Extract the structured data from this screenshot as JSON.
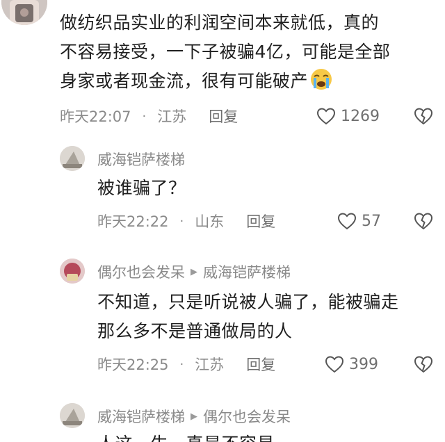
{
  "comments": [
    {
      "text_lines": [
        "做纺织品实业的利润空间本来就低，真的",
        "不容易接受，一下子被骗4亿，可能是全部",
        "身家或者现金流，很有可能破产"
      ],
      "emoji": "crying-face-emoji",
      "time": "昨天22:07",
      "location": "江苏",
      "reply_label": "回复",
      "likes": "1269"
    }
  ],
  "replies": [
    {
      "author": "威海铠萨楼梯",
      "reply_to": "",
      "text_lines": [
        "被谁骗了？"
      ],
      "time": "昨天22:22",
      "location": "山东",
      "reply_label": "回复",
      "likes": "57"
    },
    {
      "author": "偶尔也会发呆",
      "reply_to": "威海铠萨楼梯",
      "text_lines": [
        "不知道，只是听说被人骗了，能被骗走",
        "那么多不是普通做局的人"
      ],
      "time": "昨天22:25",
      "location": "江苏",
      "reply_label": "回复",
      "likes": "399"
    },
    {
      "author": "威海铠萨楼梯",
      "reply_to": "偶尔也会发呆",
      "text_lines": [
        "人这一生，真是不容易"
      ]
    }
  ],
  "separator": "·",
  "colors": {
    "text": "#1f1f1f",
    "meta": "#8a8a8a",
    "background": "#ffffff"
  }
}
